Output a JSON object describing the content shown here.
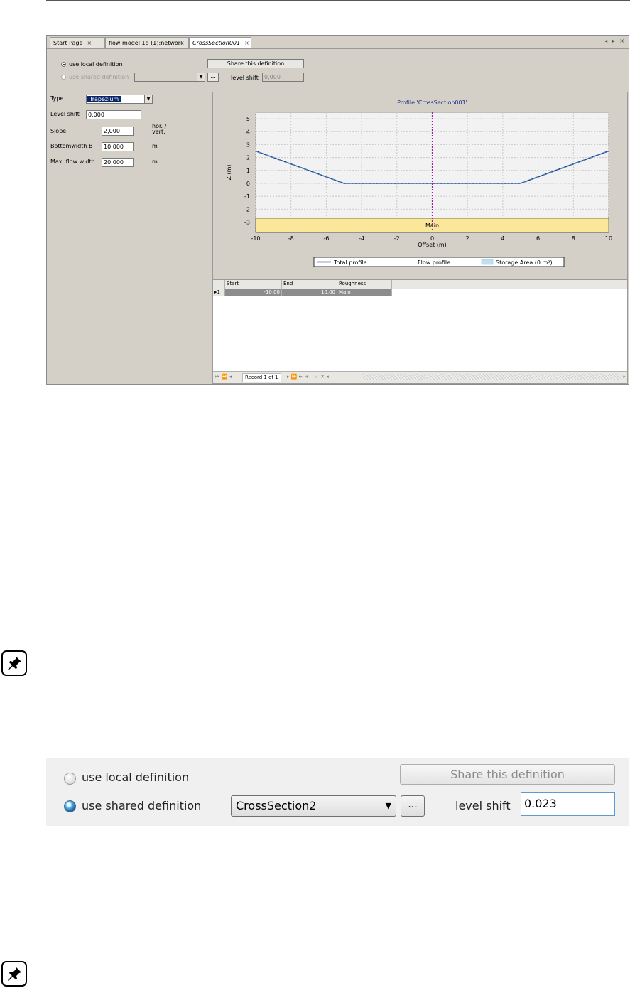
{
  "tabs": [
    {
      "label": "Start Page",
      "active": false
    },
    {
      "label": "flow model 1d (1):network",
      "active": false
    },
    {
      "label": "CrossSection001",
      "active": true
    }
  ],
  "close_glyph": "×",
  "tab_controls": "◂ ▸ ×",
  "definition": {
    "local_label": "use local definition",
    "shared_label": "use shared definition",
    "share_button": "Share this definition",
    "level_shift_label": "level shift",
    "level_shift_value": "0,000",
    "browse_label": "..."
  },
  "properties": {
    "type_label": "Type",
    "type_value": "Trapezium",
    "level_shift_label": "Level shift",
    "level_shift_value": "0,000",
    "slope_label": "Slope",
    "slope_value": "2,000",
    "slope_unit": "hor. / vert.",
    "bottomwidth_label": "Bottomwidth B",
    "bottomwidth_value": "10,000",
    "bottomwidth_unit": "m",
    "maxflow_label": "Max. flow width",
    "maxflow_value": "20,000",
    "maxflow_unit": "m"
  },
  "chart_data": {
    "type": "line",
    "title": "Profile 'CrossSection001'",
    "xlabel": "Offset (m)",
    "ylabel": "Z (m)",
    "xlim": [
      -10,
      10
    ],
    "ylim": [
      -3.8,
      5.5
    ],
    "xticks": [
      -10,
      -8,
      -6,
      -4,
      -2,
      0,
      2,
      4,
      6,
      8,
      10
    ],
    "yticks": [
      -3,
      -2,
      -1,
      0,
      1,
      2,
      3,
      4,
      5
    ],
    "grid": true,
    "series": [
      {
        "name": "Total profile",
        "x": [
          -10,
          -5,
          5,
          10
        ],
        "y": [
          2.5,
          0,
          0,
          2.5
        ],
        "color": "#2a3f8f",
        "style": "solid"
      },
      {
        "name": "Flow profile",
        "x": [
          -10,
          -5,
          5,
          10
        ],
        "y": [
          2.5,
          0,
          0,
          2.5
        ],
        "color": "#3fa0c8",
        "style": "dashed"
      }
    ],
    "storage_legend": "Storage Area (0 m²)",
    "band": {
      "label": "Main",
      "x": [
        -10,
        10
      ],
      "y": [
        -3.8,
        -2.7
      ],
      "color": "#fbe79a"
    },
    "marker_x": 0,
    "marker_color": "#9b1fa8",
    "legend_position": "bottom"
  },
  "table": {
    "columns": [
      "Start",
      "End",
      "Roughness"
    ],
    "rows": [
      {
        "indicator": "▸1",
        "start": "-10,00",
        "end": "10,00",
        "roughness": "Main"
      }
    ],
    "navigator": {
      "record": "Record 1 of 1",
      "left_ctrls": "⏮ ⏪ ◂",
      "right_ctrls": "▸ ⏩ ⏭ + – ✓ ✕ ◂",
      "scroll_right": "▸"
    }
  },
  "zoom": {
    "local_label": "use local definition",
    "shared_label": "use shared definition",
    "share_button": "Share this definition",
    "combo_value": "CrossSection2",
    "combo_arrow": "▼",
    "browse_label": "...",
    "level_shift_label": "level shift",
    "level_shift_value": "0.023"
  }
}
